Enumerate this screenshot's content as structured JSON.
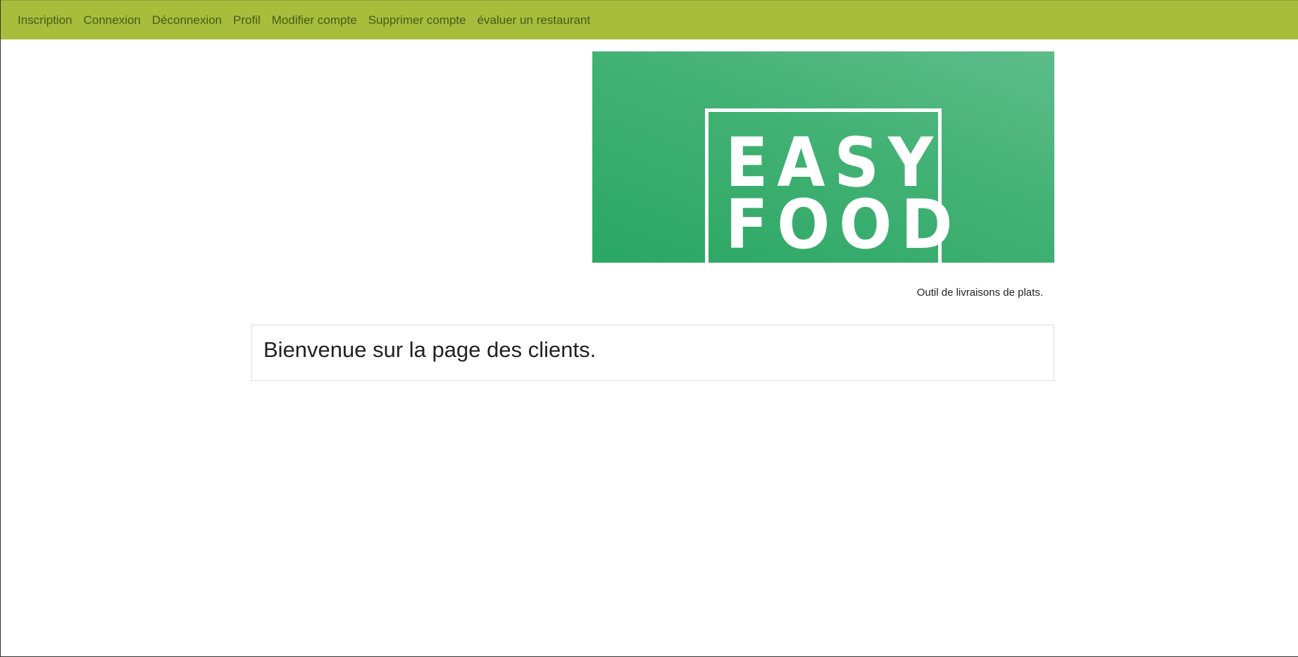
{
  "nav": {
    "items": [
      {
        "label": "Inscription"
      },
      {
        "label": "Connexion"
      },
      {
        "label": "Déconnexion"
      },
      {
        "label": "Profil"
      },
      {
        "label": "Modifier compte"
      },
      {
        "label": "Supprimer compte"
      },
      {
        "label": "évaluer un restaurant"
      }
    ],
    "background_color": "#a7bd3b"
  },
  "banner": {
    "logo_line_1": "EASY",
    "logo_line_2": "FOOD",
    "background_color": "#3fb06f"
  },
  "tagline": "Outil de livraisons de plats.",
  "main": {
    "heading": "Bienvenue sur la page des clients."
  }
}
